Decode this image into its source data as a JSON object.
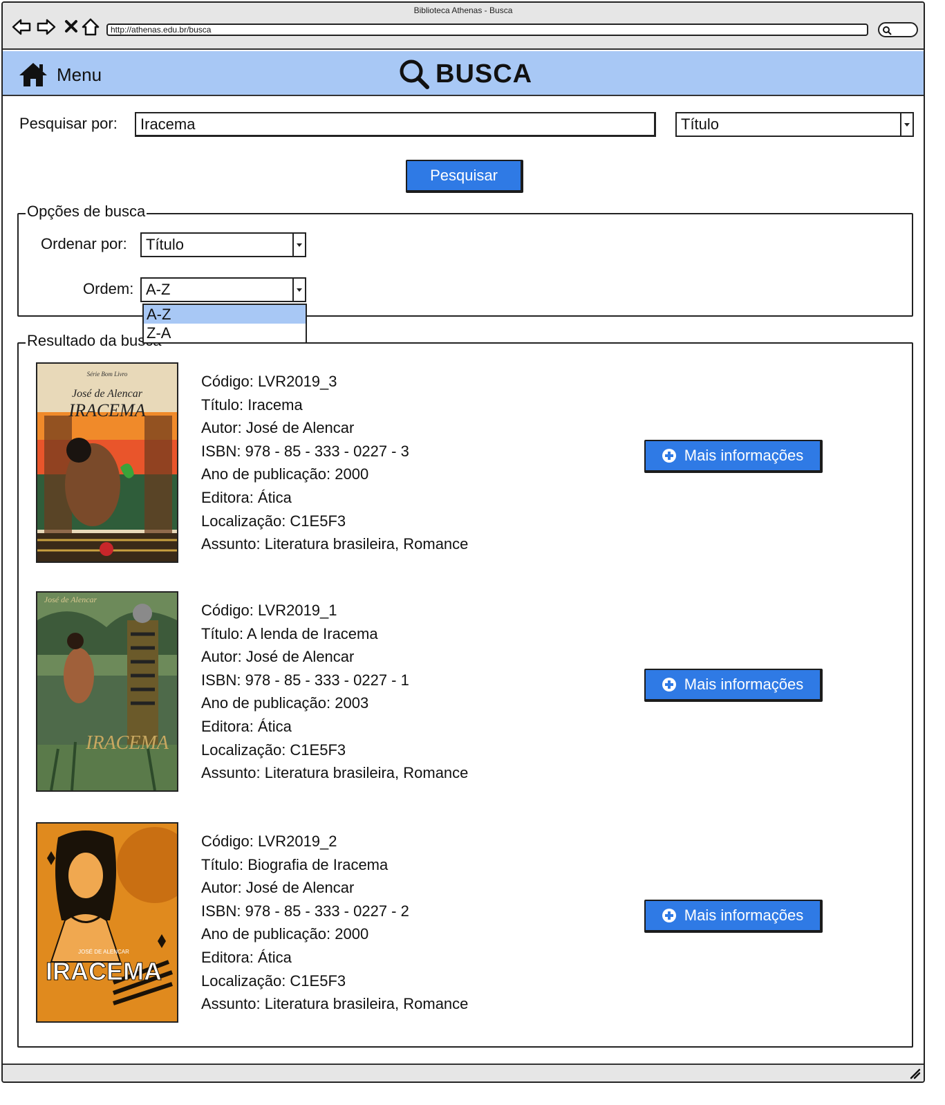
{
  "window": {
    "title": "Biblioteca Athenas - Busca",
    "url": "http://athenas.edu.br/busca"
  },
  "header": {
    "menu_label": "Menu",
    "page_title": "BUSCA",
    "bar_color": "#a8c8f5"
  },
  "search": {
    "label": "Pesquisar por:",
    "query": "Iracema",
    "field_selected": "Título",
    "button_label": "Pesquisar",
    "button_color": "#2f7ae5"
  },
  "options": {
    "legend": "Opções de busca",
    "sort_label": "Ordenar por:",
    "sort_value": "Título",
    "order_label": "Ordem:",
    "order_value": "A-Z",
    "order_options": [
      "A-Z",
      "Z-A"
    ]
  },
  "results": {
    "legend": "Resultado da busca",
    "more_label": "Mais informações",
    "items": [
      {
        "cover_author": "José de Alencar",
        "cover_title": "IRACEMA",
        "cover_series": "Série Bom Livro",
        "codigo": "Código: LVR2019_3",
        "titulo": "Título: Iracema",
        "autor": "Autor: José de Alencar",
        "isbn": "ISBN: 978 - 85 - 333 - 0227 - 3",
        "ano": "Ano de publicação: 2000",
        "editora": "Editora: Ática",
        "localizacao": "Localização: C1E5F3",
        "assunto": "Assunto: Literatura brasileira, Romance"
      },
      {
        "cover_author": "José de Alencar",
        "cover_title": "IRACEMA",
        "codigo": "Código: LVR2019_1",
        "titulo": "Título: A lenda de Iracema",
        "autor": "Autor: José de Alencar",
        "isbn": "ISBN: 978 - 85 - 333 - 0227 - 1",
        "ano": "Ano de publicação: 2003",
        "editora": "Editora: Ática",
        "localizacao": "Localização: C1E5F3",
        "assunto": "Assunto: Literatura brasileira, Romance"
      },
      {
        "cover_author": "JOSÉ DE ALENCAR",
        "cover_title": "IRACEMA",
        "codigo": "Código: LVR2019_2",
        "titulo": "Título: Biografia de Iracema",
        "autor": "Autor: José de Alencar",
        "isbn": "ISBN: 978 - 85 - 333 - 0227 - 2",
        "ano": "Ano de publicação: 2000",
        "editora": "Editora: Ática",
        "localizacao": "Localização: C1E5F3",
        "assunto": "Assunto: Literatura brasileira, Romance"
      }
    ]
  },
  "icons": {
    "back": "back-arrow-icon",
    "forward": "forward-arrow-icon",
    "stop": "close-icon",
    "home": "home-icon",
    "search": "search-icon",
    "plus": "plus-circle-icon",
    "resize": "resize-grip-icon"
  }
}
